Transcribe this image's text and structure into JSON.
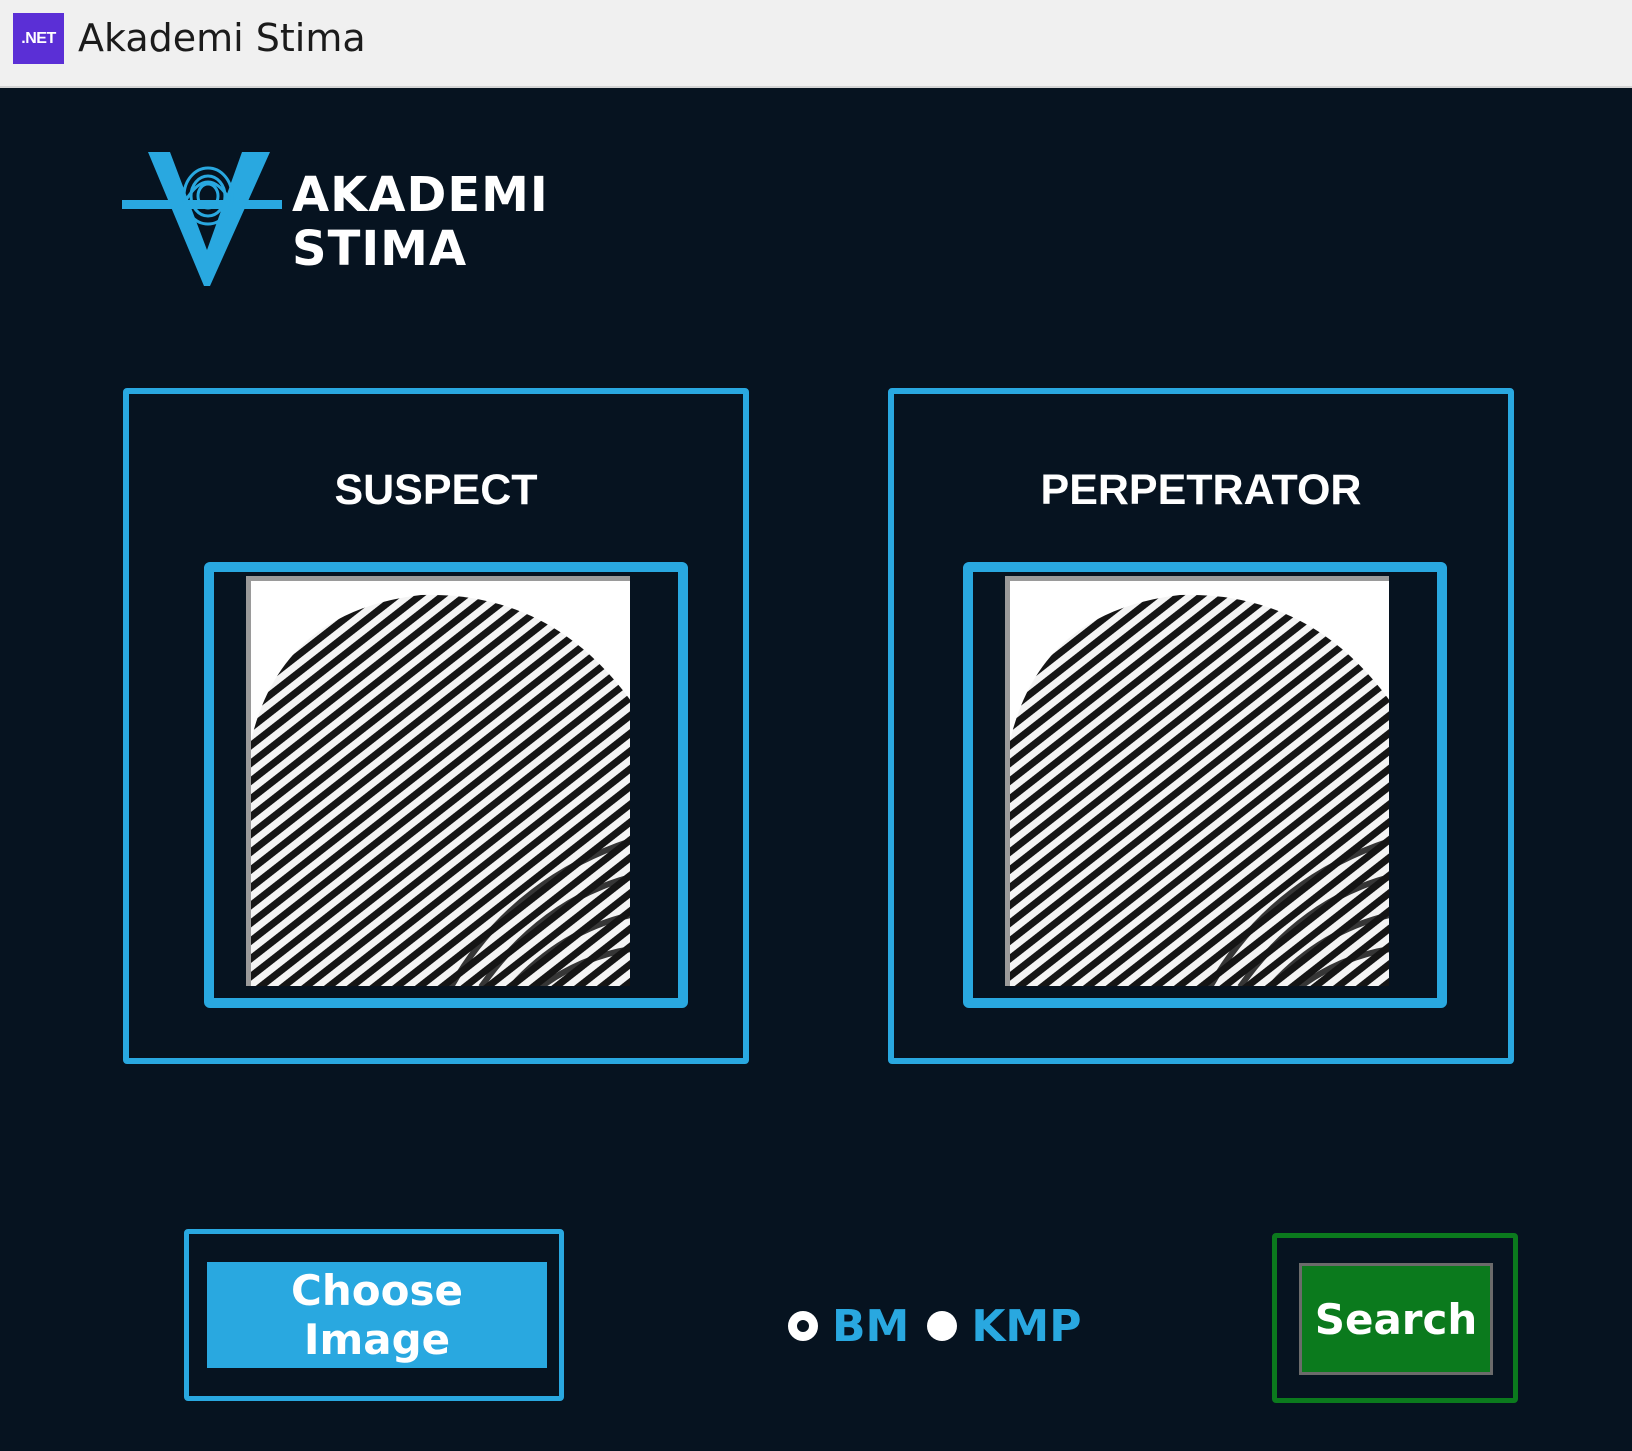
{
  "window": {
    "badge": ".NET",
    "title": "Akademi Stima"
  },
  "logo": {
    "line1": "AKADEMI",
    "line2": "STIMA",
    "icon": "fingerprint-v-logo-icon"
  },
  "panels": {
    "suspect": {
      "title": "SUSPECT",
      "image": "fingerprint-image"
    },
    "perpetrator": {
      "title": "PERPETRATOR",
      "image": "fingerprint-image"
    }
  },
  "controls": {
    "choose_label": "Choose Image",
    "algorithms": [
      {
        "label": "BM",
        "selected": false
      },
      {
        "label": "KMP",
        "selected": true
      }
    ],
    "search_label": "Search"
  },
  "colors": {
    "background": "#061320",
    "accent": "#29a8e0",
    "search_green": "#0b7a1d",
    "titlebar": "#f0f0f0",
    "net_badge": "#5b2fd6"
  }
}
